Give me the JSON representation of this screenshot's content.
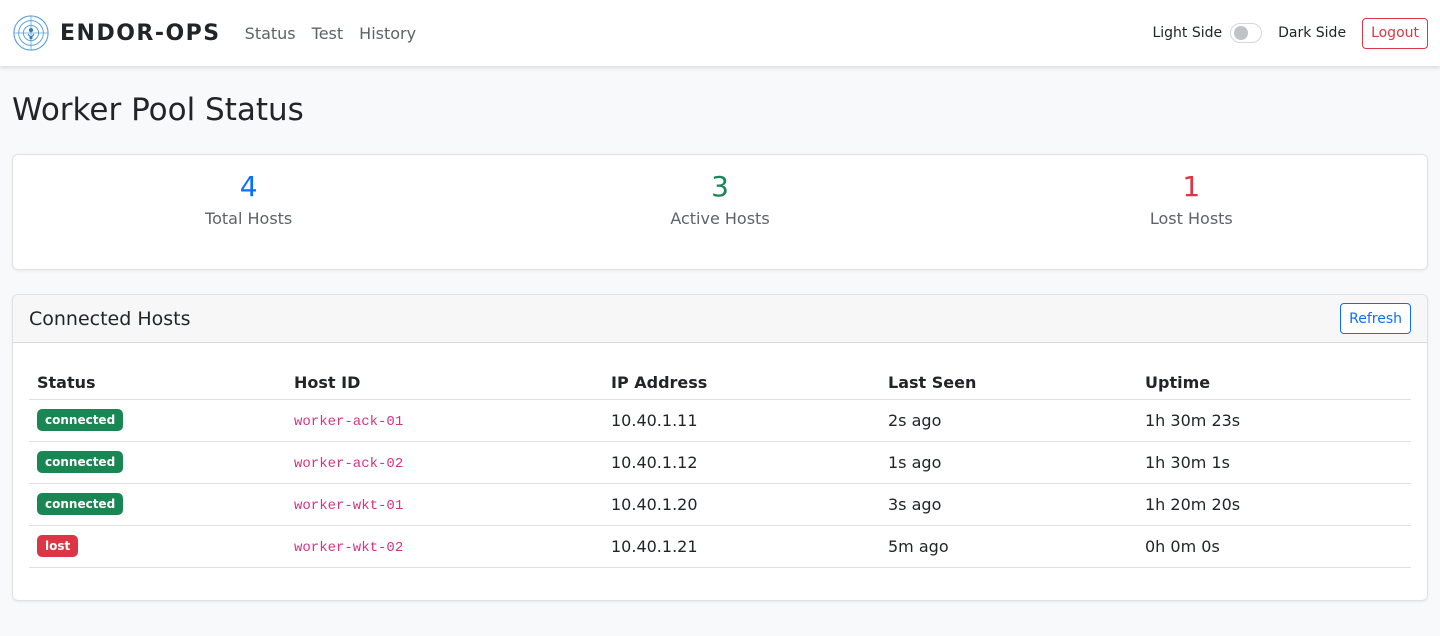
{
  "navbar": {
    "brand": "ENDOR-OPS",
    "logo_icon": "endor-ops-logo",
    "links": [
      "Status",
      "Test",
      "History"
    ],
    "theme_light": "Light Side",
    "theme_dark": "Dark Side",
    "logout": "Logout"
  },
  "page": {
    "title": "Worker Pool Status"
  },
  "stats": {
    "total": {
      "value": "4",
      "label": "Total Hosts",
      "color": "#0d6efd"
    },
    "active": {
      "value": "3",
      "label": "Active Hosts",
      "color": "#198754"
    },
    "lost": {
      "value": "1",
      "label": "Lost Hosts",
      "color": "#dc3545"
    }
  },
  "hosts": {
    "title": "Connected Hosts",
    "refresh": "Refresh",
    "columns": [
      "Status",
      "Host ID",
      "IP Address",
      "Last Seen",
      "Uptime"
    ],
    "rows": [
      {
        "status": "connected",
        "host_id": "worker-ack-01",
        "ip": "10.40.1.11",
        "last_seen": "2s ago",
        "uptime": "1h 30m 23s"
      },
      {
        "status": "connected",
        "host_id": "worker-ack-02",
        "ip": "10.40.1.12",
        "last_seen": "1s ago",
        "uptime": "1h 30m 1s"
      },
      {
        "status": "connected",
        "host_id": "worker-wkt-01",
        "ip": "10.40.1.20",
        "last_seen": "3s ago",
        "uptime": "1h 20m 20s"
      },
      {
        "status": "lost",
        "host_id": "worker-wkt-02",
        "ip": "10.40.1.21",
        "last_seen": "5m ago",
        "uptime": "0h 0m 0s"
      }
    ]
  },
  "colors": {
    "connected": "#198754",
    "lost": "#dc3545",
    "accent": "#0d6efd"
  }
}
